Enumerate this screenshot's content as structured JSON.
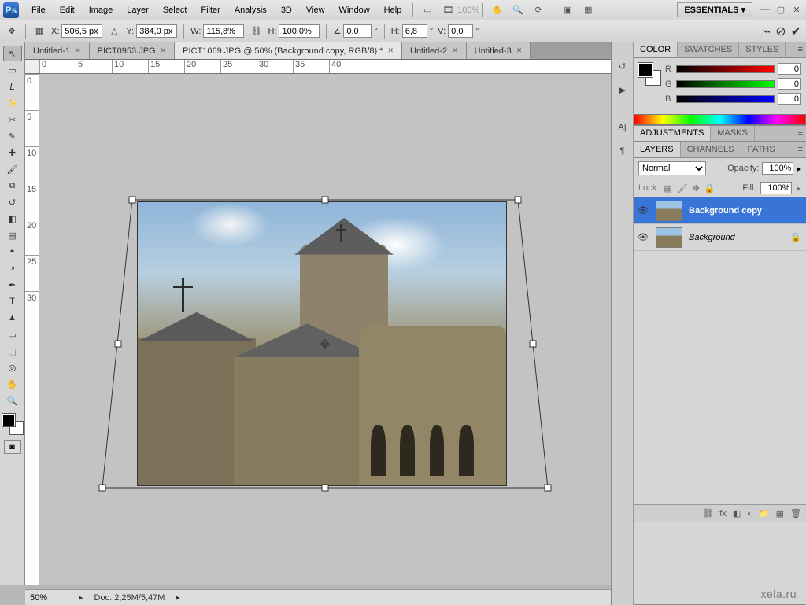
{
  "menubar": {
    "items": [
      "File",
      "Edit",
      "Image",
      "Layer",
      "Select",
      "Filter",
      "Analysis",
      "3D",
      "View",
      "Window",
      "Help"
    ],
    "workspace": "ESSENTIALS ▾",
    "zoom_readout": "100%"
  },
  "optbar": {
    "x_label": "X:",
    "x": "506,5 px",
    "y_label": "Y:",
    "y": "384,0 px",
    "w_label": "W:",
    "w": "115,8%",
    "h_label": "H:",
    "h": "100,0%",
    "angle_label": "∠",
    "angle": "0,0",
    "angle_deg": "°",
    "hskew_label": "H:",
    "hskew": "6,8",
    "hskew_deg": "°",
    "vskew_label": "V:",
    "vskew": "0,0",
    "vskew_deg": "°"
  },
  "tabs": [
    {
      "label": "Untitled-1",
      "active": false
    },
    {
      "label": "PICT0953.JPG",
      "active": false
    },
    {
      "label": "PICT1069.JPG @ 50% (Background copy, RGB/8) *",
      "active": true
    },
    {
      "label": "Untitled-2",
      "active": false
    },
    {
      "label": "Untitled-3",
      "active": false
    }
  ],
  "ruler_h": [
    "0",
    "5",
    "10",
    "15",
    "20",
    "25",
    "30",
    "35",
    "40"
  ],
  "ruler_v": [
    "0",
    "5",
    "10",
    "15",
    "20",
    "25",
    "30"
  ],
  "status": {
    "zoom": "50%",
    "doc": "Doc: 2,25M/5,47M"
  },
  "panels": {
    "color": {
      "tabs": [
        "COLOR",
        "SWATCHES",
        "STYLES"
      ],
      "channels": [
        {
          "ch": "R",
          "val": "0"
        },
        {
          "ch": "G",
          "val": "0"
        },
        {
          "ch": "B",
          "val": "0"
        }
      ]
    },
    "adjustments": {
      "tabs": [
        "ADJUSTMENTS",
        "MASKS"
      ]
    },
    "layers": {
      "tabs": [
        "LAYERS",
        "CHANNELS",
        "PATHS"
      ],
      "blend": "Normal",
      "opacity_label": "Opacity:",
      "opacity": "100%",
      "lock_label": "Lock:",
      "fill_label": "Fill:",
      "fill": "100%",
      "items": [
        {
          "name": "Background copy",
          "selected": true,
          "locked": false
        },
        {
          "name": "Background",
          "selected": false,
          "locked": true
        }
      ]
    }
  },
  "watermark": "xela.ru",
  "icons": {
    "ps": "Ps",
    "triangle": "▾",
    "hand": "✋",
    "zoom": "🔍",
    "rotate": "⟳",
    "screen": "▣",
    "arrange": "▦",
    "commit": "✔",
    "cancel": "⊘",
    "warp": "⌁",
    "eye": "👁",
    "lock": "🔒",
    "link": "⛓",
    "fx": "fx",
    "mask": "◧",
    "folder": "📁",
    "new": "▦",
    "trash": "🗑",
    "menu": "≡",
    "play": "▶",
    "char": "A|",
    "para": "¶",
    "history": "↺"
  }
}
